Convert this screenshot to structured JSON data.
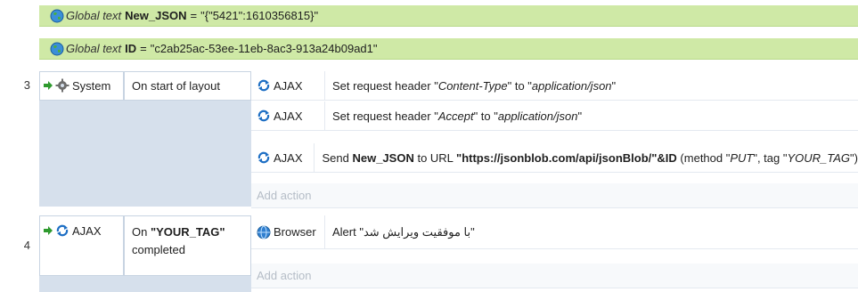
{
  "globals": [
    {
      "keyword": "Global text",
      "name": "New_JSON",
      "eq": "=",
      "value": "\"{\"5421\":1610356815}\""
    },
    {
      "keyword": "Global text",
      "name": "ID",
      "eq": "=",
      "value": "\"c2ab25ac-53ee-11eb-8ac3-913a24b09ad1\""
    }
  ],
  "events": [
    {
      "number": "3",
      "condition_object": "System",
      "condition_text": "On start of layout",
      "actions": [
        {
          "object": "AJAX",
          "parts": [
            "Set request header \"",
            "Content-Type",
            "\" to \"",
            "application/json",
            "\""
          ]
        },
        {
          "object": "AJAX",
          "parts": [
            "Set request header \"",
            "Accept",
            "\" to \"",
            "application/json",
            "\""
          ]
        },
        {
          "object": "AJAX",
          "parts": [
            "Send ",
            "New_JSON",
            " to URL ",
            "\"https://jsonblob.com/api/jsonBlob/\"&ID",
            " (method \"",
            "PUT",
            "\", tag \"",
            "YOUR_TAG",
            "\")"
          ]
        }
      ],
      "add_action": "Add action"
    },
    {
      "number": "4",
      "condition_object": "AJAX",
      "condition_text_prefix": "On ",
      "condition_text_tag": "\"YOUR_TAG\"",
      "condition_text_suffix": "completed",
      "actions": [
        {
          "object": "Browser",
          "parts": [
            "Alert ",
            "\"با موفقیت ویرایش شد\""
          ]
        }
      ],
      "add_action": "Add action"
    }
  ],
  "colors": {
    "global_bg": "#cfe9a6",
    "event_bar": "#d6e0ec",
    "green_arrow": "#2e9a2e",
    "ajax_blue": "#1e6fc4"
  },
  "icons": [
    "globe-icon",
    "gear-icon",
    "ajax-icon",
    "browser-icon",
    "green-arrow-icon"
  ]
}
